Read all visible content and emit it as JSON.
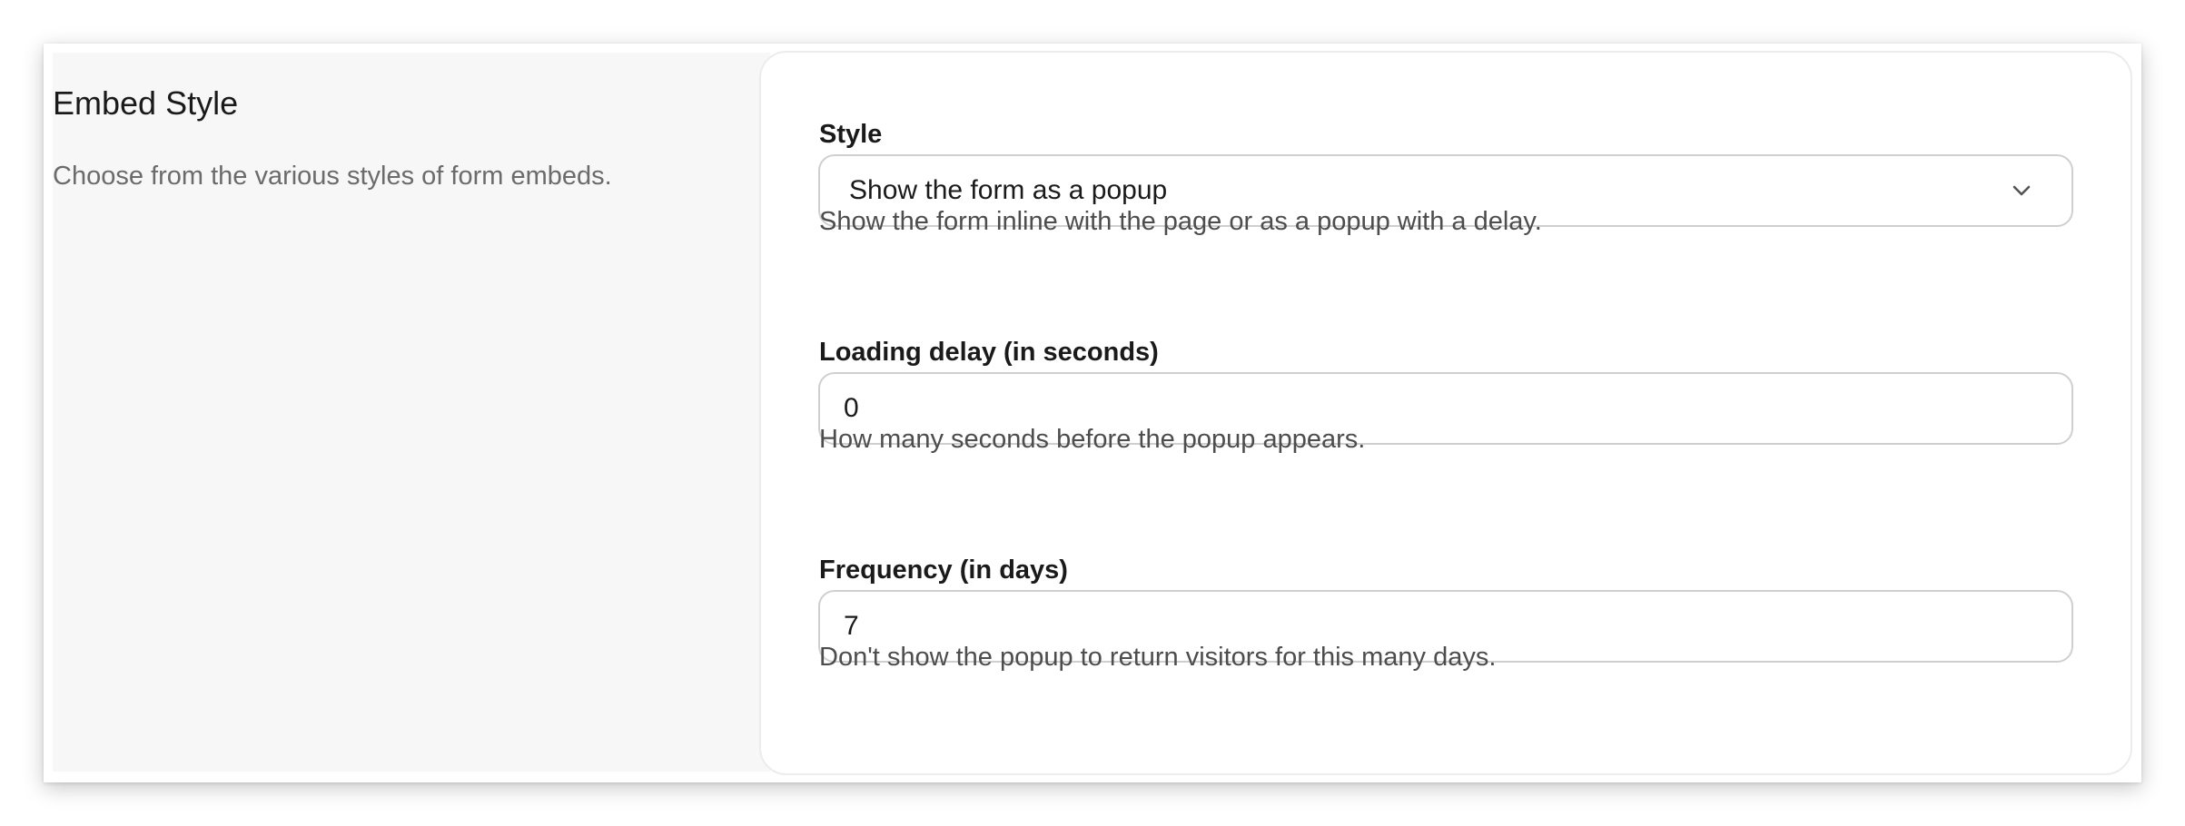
{
  "section": {
    "title": "Embed Style",
    "description": "Choose from the various styles of form embeds."
  },
  "fields": {
    "style": {
      "label": "Style",
      "value": "Show the form as a popup",
      "help": "Show the form inline with the page or as a popup with a delay.",
      "icon": "chevron-down-icon"
    },
    "loading_delay": {
      "label": "Loading delay (in seconds)",
      "value": "0",
      "help": "How many seconds before the popup appears."
    },
    "frequency": {
      "label": "Frequency (in days)",
      "value": "7",
      "help": "Don't show the popup to return visitors for this many days."
    }
  },
  "colors": {
    "panel_background": "#f7f7f7",
    "border": "#cfcfcf",
    "text": "#1a1a1a",
    "muted_text": "#6b6b6b"
  }
}
